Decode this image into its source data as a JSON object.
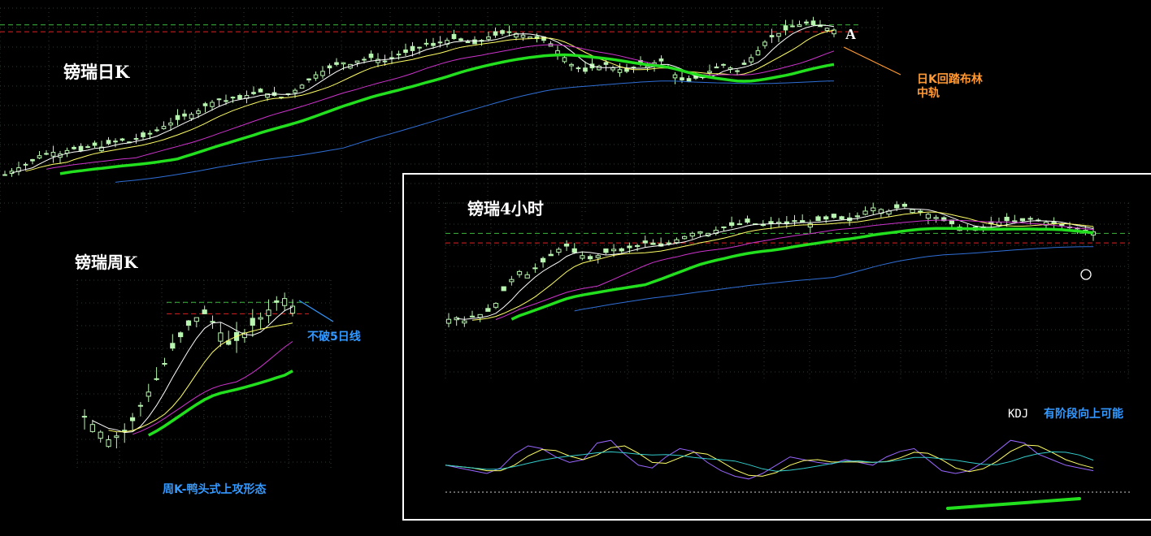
{
  "colors": {
    "background": "#000000",
    "grid": "#2e3a2e",
    "candle": "#b8f5b0",
    "ma5": "#ffffff",
    "ma10": "#ffff66",
    "ma20": "#cc33cc",
    "boll_mid": "#22e01e",
    "ma60": "#2f6fd6",
    "resistance": "#3db63d",
    "support": "#e02020",
    "orange_note": "#ff9933",
    "blue_note": "#3399ff",
    "k_line": "#9966ff",
    "d_line": "#ffff66",
    "j_line": "#33cccc",
    "frame": "#ffffff"
  },
  "annotations": {
    "daily_title": "镑瑞日K",
    "weekly_title": "镑瑞周K",
    "h4_title": "镑瑞4小时",
    "point_a": "A",
    "daily_note_line1": "日K回踏布林",
    "daily_note_line2": "中轨",
    "weekly_note": "不破5日线",
    "weekly_caption": "周K-鸭头式上攻形态",
    "kdj_label": "KDJ",
    "kdj_note": "有阶段向上可能"
  },
  "chart_data": [
    {
      "type": "candlestick",
      "name": "daily",
      "title": "镑瑞日K",
      "ylim": [
        0,
        100
      ],
      "close": [
        8,
        10,
        12,
        14,
        16,
        19,
        20,
        21,
        20,
        22,
        23,
        22,
        24,
        25,
        24,
        26,
        27,
        28,
        27,
        29,
        30,
        32,
        34,
        36,
        38,
        40,
        42,
        43,
        45,
        48,
        50,
        52,
        51,
        53,
        52,
        54,
        55,
        56,
        55,
        54,
        53,
        55,
        57,
        60,
        63,
        66,
        68,
        70,
        72,
        73,
        72,
        74,
        75,
        76,
        75,
        74,
        76,
        78,
        79,
        80,
        82,
        84,
        83,
        85,
        86,
        87,
        86,
        85,
        84,
        86,
        88,
        89,
        90,
        91,
        90,
        89,
        88,
        87,
        86,
        84,
        80,
        76,
        72,
        70,
        68,
        70,
        71,
        72,
        70,
        69,
        68,
        70,
        72,
        71,
        73,
        74,
        70,
        66,
        63,
        62,
        64,
        66,
        68,
        70,
        72,
        70,
        68,
        72,
        76,
        80,
        85,
        88,
        90,
        92,
        94,
        95,
        96,
        95,
        94,
        93,
        92
      ],
      "lines": [
        {
          "name": "MA5",
          "color": "#ffffff"
        },
        {
          "name": "MA10",
          "color": "#ffff66"
        },
        {
          "name": "MA20",
          "color": "#cc33cc"
        },
        {
          "name": "BOLL-MID",
          "color": "#22e01e"
        },
        {
          "name": "MA60",
          "color": "#2f6fd6"
        }
      ],
      "levels": {
        "resistance": 95,
        "support": 91
      }
    },
    {
      "type": "candlestick",
      "name": "weekly",
      "title": "镑瑞周K",
      "ylim": [
        0,
        100
      ],
      "close": [
        22,
        18,
        14,
        10,
        12,
        15,
        20,
        28,
        35,
        42,
        50,
        58,
        64,
        70,
        74,
        76,
        72,
        66,
        60,
        62,
        66,
        70,
        74,
        78,
        82,
        84,
        80
      ],
      "lines": [
        {
          "name": "MA5",
          "color": "#ffffff"
        },
        {
          "name": "MA10",
          "color": "#ffff66"
        },
        {
          "name": "MA20",
          "color": "#cc33cc"
        },
        {
          "name": "BOLL-MID",
          "color": "#22e01e"
        }
      ],
      "levels": {
        "resistance": 82,
        "support": 76
      }
    },
    {
      "type": "candlestick",
      "name": "h4",
      "title": "镑瑞4小时",
      "ylim": [
        0,
        100
      ],
      "close": [
        30,
        31,
        29,
        32,
        33,
        35,
        40,
        48,
        55,
        60,
        58,
        62,
        66,
        70,
        74,
        76,
        72,
        70,
        68,
        70,
        72,
        74,
        73,
        75,
        76,
        78,
        77,
        76,
        78,
        80,
        82,
        84,
        85,
        84,
        86,
        88,
        89,
        90,
        91,
        90,
        89,
        90,
        91,
        90,
        92,
        91,
        90,
        92,
        93,
        94,
        93,
        92,
        95,
        98,
        100,
        99,
        98,
        100,
        101,
        99,
        98,
        96,
        94,
        92,
        90,
        88,
        87,
        86,
        88,
        90,
        91,
        92,
        91,
        92,
        93,
        92,
        91,
        90,
        89,
        88,
        87,
        86,
        85
      ],
      "lines": [
        {
          "name": "MA5",
          "color": "#ffffff"
        },
        {
          "name": "MA10",
          "color": "#ffff66"
        },
        {
          "name": "MA20",
          "color": "#cc33cc"
        },
        {
          "name": "BOLL-MID",
          "color": "#22e01e"
        },
        {
          "name": "MA60",
          "color": "#2f6fd6"
        }
      ],
      "levels": {
        "resistance": 84,
        "support": 78
      }
    },
    {
      "type": "line",
      "name": "kdj",
      "title": "KDJ",
      "ylim": [
        0,
        100
      ],
      "series": [
        {
          "name": "K",
          "values": [
            40,
            35,
            30,
            25,
            35,
            60,
            75,
            70,
            55,
            45,
            50,
            80,
            85,
            60,
            40,
            35,
            55,
            70,
            65,
            45,
            30,
            20,
            15,
            25,
            40,
            55,
            50,
            45,
            42,
            50,
            45,
            40,
            55,
            65,
            70,
            50,
            30,
            25,
            30,
            45,
            65,
            85,
            80,
            60,
            50,
            40,
            35,
            30
          ]
        }
      ]
    }
  ]
}
